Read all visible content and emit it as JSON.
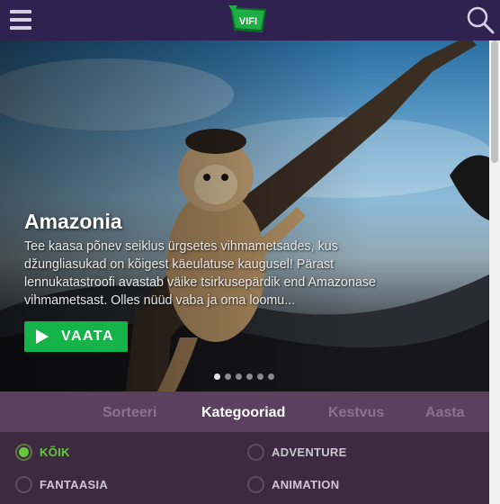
{
  "header": {
    "logo_text": "VIFI",
    "menu_icon": "hamburger-menu-icon",
    "search_icon": "search-icon"
  },
  "hero": {
    "title": "Amazonia",
    "description": "Tee kaasa põnev seiklus ürgsetes vihmametsades, kus džungliasukad on kõigest käeulatuse kaugusel! Pärast lennukatastroofi avastab väike tsirkusepärdik end Amazonase vihmametsast. Olles nüüd vaba ja oma loomu...",
    "watch_label": "VAATA",
    "slide_count": 6,
    "active_slide": 1
  },
  "tabs": [
    {
      "label": "Sorteeri",
      "active": false
    },
    {
      "label": "Kategooriad",
      "active": true
    },
    {
      "label": "Kestvus",
      "active": false
    },
    {
      "label": "Aasta",
      "active": false
    }
  ],
  "filters": [
    {
      "label": "KÕIK",
      "selected": true
    },
    {
      "label": "ADVENTURE",
      "selected": false
    },
    {
      "label": "FANTAASIA",
      "selected": false
    },
    {
      "label": "ANIMATION",
      "selected": false
    }
  ],
  "colors": {
    "topbar": "#2f2150",
    "accent_green": "#16b24a",
    "selected_green": "#63c93b",
    "tabs_bg": "#5b4060",
    "filters_bg": "#3d2a40"
  }
}
